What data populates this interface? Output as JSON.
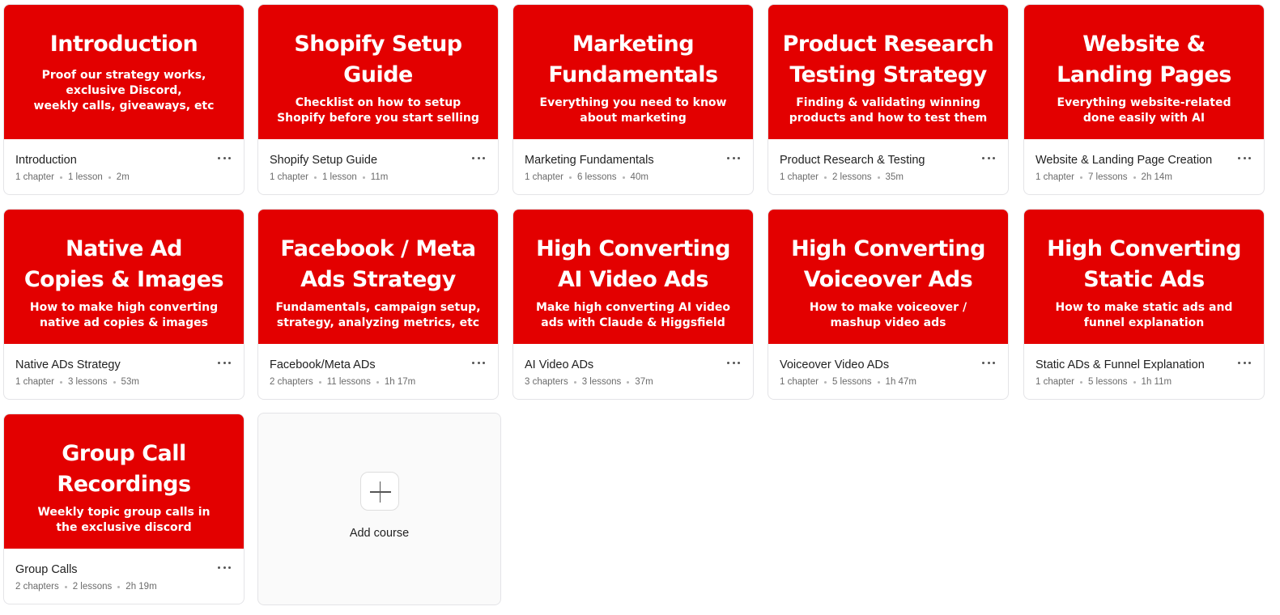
{
  "courses": [
    {
      "banner_title": "Introduction",
      "banner_subtitle": "Proof our strategy works,\nexclusive Discord,\nweekly calls, giveaways, etc",
      "name": "Introduction",
      "chapters": "1 chapter",
      "lessons": "1 lesson",
      "duration": "2m"
    },
    {
      "banner_title": "Shopify Setup\nGuide",
      "banner_subtitle": "Checklist on how to setup\nShopify before you start selling",
      "name": "Shopify Setup Guide",
      "chapters": "1 chapter",
      "lessons": "1 lesson",
      "duration": "11m"
    },
    {
      "banner_title": "Marketing\nFundamentals",
      "banner_subtitle": "Everything you need to know\nabout marketing",
      "name": "Marketing Fundamentals",
      "chapters": "1 chapter",
      "lessons": "6 lessons",
      "duration": "40m"
    },
    {
      "banner_title": "Product Research\nTesting Strategy",
      "banner_subtitle": "Finding & validating winning\nproducts and how to test them",
      "name": "Product Research & Testing",
      "chapters": "1 chapter",
      "lessons": "2 lessons",
      "duration": "35m"
    },
    {
      "banner_title": "Website &\nLanding Pages",
      "banner_subtitle": "Everything website-related\ndone easily with AI",
      "name": "Website & Landing Page Creation",
      "chapters": "1 chapter",
      "lessons": "7 lessons",
      "duration": "2h 14m"
    },
    {
      "banner_title": "Native Ad\nCopies & Images",
      "banner_subtitle": "How to make high converting\nnative ad copies & images",
      "name": "Native ADs Strategy",
      "chapters": "1 chapter",
      "lessons": "3 lessons",
      "duration": "53m"
    },
    {
      "banner_title": "Facebook / Meta\nAds Strategy",
      "banner_subtitle": "Fundamentals, campaign setup,\nstrategy, analyzing metrics, etc",
      "name": "Facebook/Meta ADs",
      "chapters": "2 chapters",
      "lessons": "11 lessons",
      "duration": "1h 17m"
    },
    {
      "banner_title": "High Converting\nAI Video Ads",
      "banner_subtitle": "Make high converting AI video\nads with Claude & Higgsfield",
      "name": "AI Video ADs",
      "chapters": "3 chapters",
      "lessons": "3 lessons",
      "duration": "37m"
    },
    {
      "banner_title": "High Converting\nVoiceover Ads",
      "banner_subtitle": "How to make voiceover /\nmashup video ads",
      "name": "Voiceover Video ADs",
      "chapters": "1 chapter",
      "lessons": "5 lessons",
      "duration": "1h 47m"
    },
    {
      "banner_title": "High Converting\nStatic Ads",
      "banner_subtitle": "How to make static ads and\nfunnel explanation",
      "name": "Static ADs & Funnel Explanation",
      "chapters": "1 chapter",
      "lessons": "5 lessons",
      "duration": "1h 11m"
    },
    {
      "banner_title": "Group Call\nRecordings",
      "banner_subtitle": "Weekly topic group calls in\nthe exclusive discord",
      "name": "Group Calls",
      "chapters": "2 chapters",
      "lessons": "2 lessons",
      "duration": "2h 19m"
    }
  ],
  "add_course": {
    "label": "Add course"
  },
  "colors": {
    "banner": "#e30000",
    "border": "#e4e4e7",
    "add_bg": "#fafafa"
  },
  "icons": {
    "more": "more-horizontal-icon",
    "add": "plus-icon"
  }
}
